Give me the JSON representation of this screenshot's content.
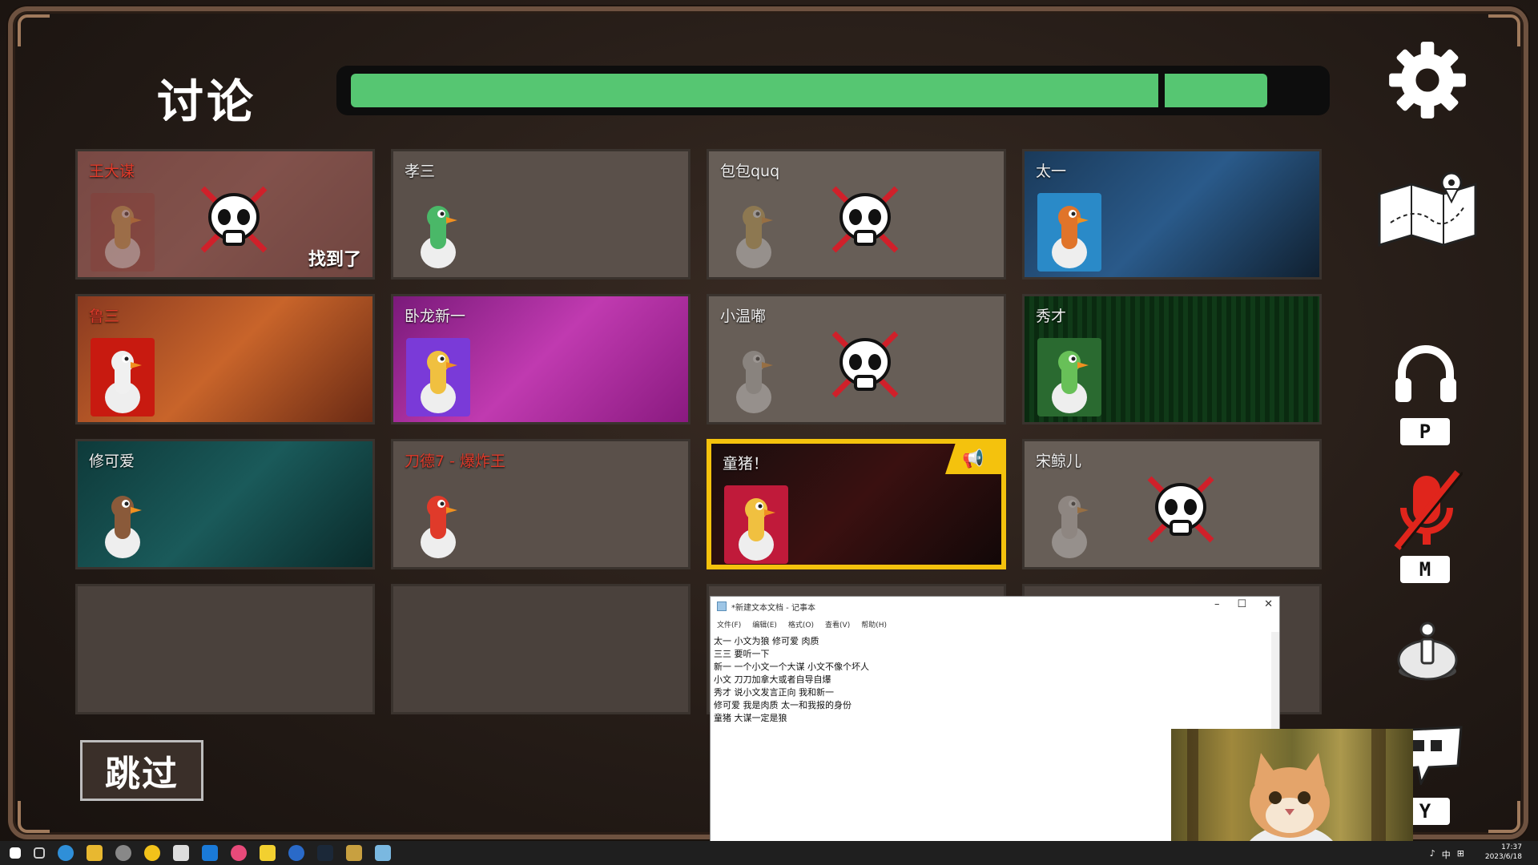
{
  "header": {
    "title": "讨论"
  },
  "timer": {
    "progress": 0.95
  },
  "players": [
    {
      "name": "王大谋",
      "name_color": "red",
      "status": "dead",
      "found_label": "找到了",
      "theme": "canada"
    },
    {
      "name": "孝三",
      "name_color": "white",
      "status": "alive",
      "theme": "plain"
    },
    {
      "name": "包包quq",
      "name_color": "white",
      "status": "dead",
      "theme": "plain"
    },
    {
      "name": "太一",
      "name_color": "white",
      "status": "alive",
      "theme": "blue"
    },
    {
      "name": "鲁三",
      "name_color": "red",
      "status": "alive",
      "theme": "orange"
    },
    {
      "name": "卧龙新一",
      "name_color": "white",
      "status": "alive",
      "theme": "hearts"
    },
    {
      "name": "小温嘟",
      "name_color": "white",
      "status": "dead",
      "theme": "plain"
    },
    {
      "name": "秀才",
      "name_color": "white",
      "status": "alive",
      "theme": "matrix"
    },
    {
      "name": "修可爱",
      "name_color": "white",
      "status": "alive",
      "theme": "bubbles"
    },
    {
      "name": "刀德7 - 爆炸王",
      "name_color": "red",
      "status": "alive",
      "theme": "plain"
    },
    {
      "name": "童猪！",
      "name_color": "white",
      "status": "speaking",
      "theme": "dark"
    },
    {
      "name": "宋鲸儿",
      "name_color": "white",
      "status": "dead",
      "theme": "plain"
    }
  ],
  "skip_button": {
    "label": "跳过"
  },
  "side_controls": {
    "push_to_talk_key": "P",
    "mute_key": "M",
    "chat_key": "Y"
  },
  "notepad": {
    "title": "*新建文本文档 - 记事本",
    "menu": [
      "文件(F)",
      "编辑(E)",
      "格式(O)",
      "查看(V)",
      "帮助(H)"
    ],
    "lines": [
      "太一  小文为狼 修可爱 肉质",
      "三三 要听一下",
      "新一 一个小文一个大谋  小文不像个坏人",
      "小文 刀刀加拿大或者自导自爆",
      "秀才 说小文发言正向 我和新一",
      "修可爱 我是肉质 太一和我报的身份",
      "童猪 大谋一定是狼"
    ]
  },
  "taskbar": {
    "time": "17:37",
    "date": "2023/6/18",
    "ime": "中"
  }
}
